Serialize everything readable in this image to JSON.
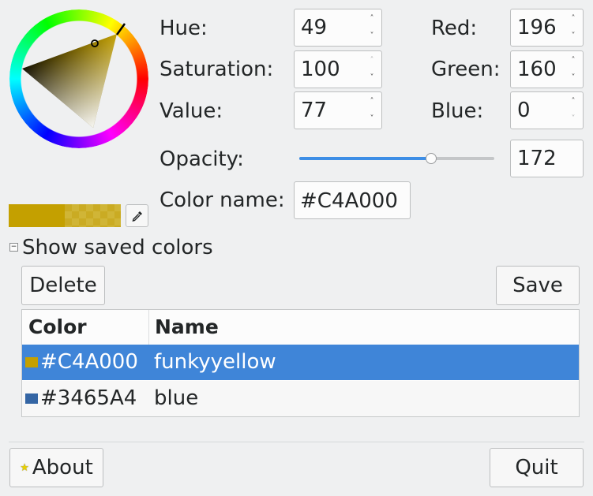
{
  "color": {
    "hue_label": "Hue:",
    "hue": "49",
    "saturation_label": "Saturation:",
    "saturation": "100",
    "value_label": "Value:",
    "value": "77",
    "red_label": "Red:",
    "red": "196",
    "green_label": "Green:",
    "green": "160",
    "blue_label": "Blue:",
    "blue": "0",
    "opacity_label": "Opacity:",
    "opacity": "172",
    "opacity_fraction": 0.6745,
    "name_label": "Color name:",
    "name": "#C4A000",
    "current_hex": "#C4A000"
  },
  "saved": {
    "toggle_label": "Show saved colors",
    "delete_label": "Delete",
    "save_label": "Save",
    "columns": [
      "Color",
      "Name"
    ],
    "rows": [
      {
        "hex": "#C4A000",
        "name": "funkyyellow",
        "swatch": "#C4A000",
        "selected": true
      },
      {
        "hex": "#3465A4",
        "name": "blue",
        "swatch": "#3465A4",
        "selected": false
      }
    ]
  },
  "footer": {
    "about_label": "About",
    "quit_label": "Quit"
  },
  "colors": {
    "accent": "#3d8ee6",
    "selection": "#3f85d8",
    "window_bg": "#eff0f1"
  }
}
